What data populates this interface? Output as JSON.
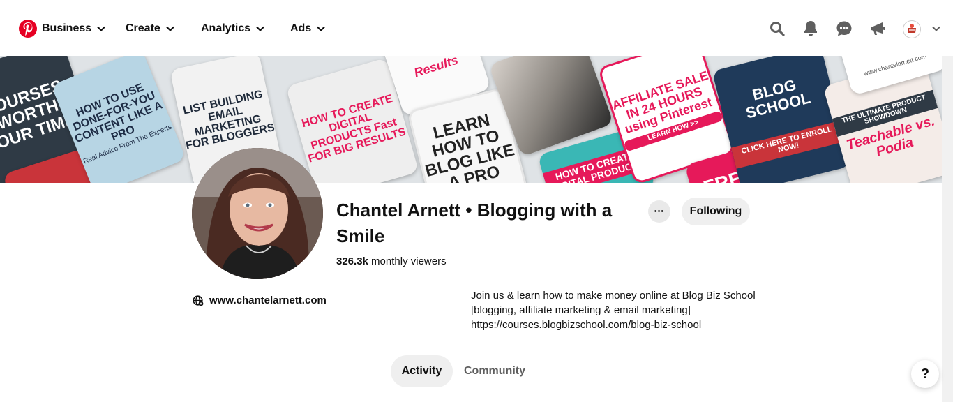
{
  "nav": {
    "items": [
      {
        "label": "Business"
      },
      {
        "label": "Create"
      },
      {
        "label": "Analytics"
      },
      {
        "label": "Ads"
      }
    ],
    "icons": [
      "search-icon",
      "notifications-bell-icon",
      "messages-icon",
      "updates-megaphone-icon"
    ],
    "brand_color": "#e60023"
  },
  "cover": {
    "pins": [
      {
        "text": "COURSES WORTH YOUR TIME!"
      },
      {
        "text": "HOW TO USE DONE-FOR-YOU CONTENT LIKE A PRO"
      },
      {
        "text": "Real Advice From The Experts"
      },
      {
        "text": "LIST BUILDING EMAIL MARKETING FOR BLOGGERS"
      },
      {
        "text": "HOW TO CREATE DIGITAL PRODUCTS Fast FOR BIG RESULTS"
      },
      {
        "text": "Results"
      },
      {
        "text": "LEARN HOW TO BLOG LIKE A PRO"
      },
      {
        "text": "HOW TO CREATE DIGITAL PRODUCTS"
      },
      {
        "text": "AFFILIATE SALE IN 24 HOURS using Pinterest"
      },
      {
        "text": "LEARN HOW >>"
      },
      {
        "text": "FREE"
      },
      {
        "text": "BLOG SCHOOL"
      },
      {
        "text": "CLICK HERE TO ENROLL NOW!"
      },
      {
        "text": "THE ULTIMATE PRODUCT SHOWDOWN"
      },
      {
        "text": "Teachable vs. Podia"
      },
      {
        "text": "www.chantelarnett.com"
      }
    ]
  },
  "profile": {
    "name": "Chantel Arnett • Blogging with a Smile",
    "more_label": "•••",
    "following_label": "Following",
    "viewers_count": "326.3k",
    "viewers_label": " monthly viewers",
    "website": "www.chantelarnett.com",
    "bio": "Join us & learn how to make money online at Blog Biz School [blogging, affiliate marketing & email marketing] https://courses.blogbizschool.com/blog-biz-school"
  },
  "tabs": [
    {
      "label": "Activity",
      "selected": true
    },
    {
      "label": "Community",
      "selected": false
    }
  ],
  "help_label": "?"
}
